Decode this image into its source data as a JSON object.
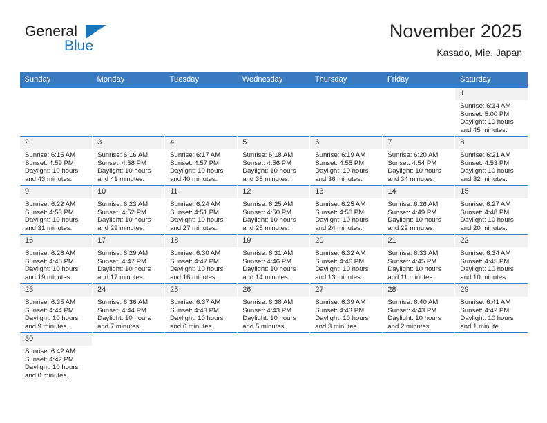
{
  "brand": {
    "name_part1": "General",
    "name_part2": "Blue",
    "flag_icon": "triangle-flag-icon",
    "accent_color": "#1b75bb"
  },
  "header": {
    "title": "November 2025",
    "subtitle": "Kasado, Mie, Japan"
  },
  "calendar": {
    "header_bg": "#3a7ac0",
    "daynum_bg": "#f2f2f2",
    "weekdays": [
      "Sunday",
      "Monday",
      "Tuesday",
      "Wednesday",
      "Thursday",
      "Friday",
      "Saturday"
    ],
    "weeks": [
      [
        {
          "day": "",
          "blank": true
        },
        {
          "day": "",
          "blank": true
        },
        {
          "day": "",
          "blank": true
        },
        {
          "day": "",
          "blank": true
        },
        {
          "day": "",
          "blank": true
        },
        {
          "day": "",
          "blank": true
        },
        {
          "day": "1",
          "sunrise": "Sunrise: 6:14 AM",
          "sunset": "Sunset: 5:00 PM",
          "daylight": "Daylight: 10 hours and 45 minutes."
        }
      ],
      [
        {
          "day": "2",
          "sunrise": "Sunrise: 6:15 AM",
          "sunset": "Sunset: 4:59 PM",
          "daylight": "Daylight: 10 hours and 43 minutes."
        },
        {
          "day": "3",
          "sunrise": "Sunrise: 6:16 AM",
          "sunset": "Sunset: 4:58 PM",
          "daylight": "Daylight: 10 hours and 41 minutes."
        },
        {
          "day": "4",
          "sunrise": "Sunrise: 6:17 AM",
          "sunset": "Sunset: 4:57 PM",
          "daylight": "Daylight: 10 hours and 40 minutes."
        },
        {
          "day": "5",
          "sunrise": "Sunrise: 6:18 AM",
          "sunset": "Sunset: 4:56 PM",
          "daylight": "Daylight: 10 hours and 38 minutes."
        },
        {
          "day": "6",
          "sunrise": "Sunrise: 6:19 AM",
          "sunset": "Sunset: 4:55 PM",
          "daylight": "Daylight: 10 hours and 36 minutes."
        },
        {
          "day": "7",
          "sunrise": "Sunrise: 6:20 AM",
          "sunset": "Sunset: 4:54 PM",
          "daylight": "Daylight: 10 hours and 34 minutes."
        },
        {
          "day": "8",
          "sunrise": "Sunrise: 6:21 AM",
          "sunset": "Sunset: 4:53 PM",
          "daylight": "Daylight: 10 hours and 32 minutes."
        }
      ],
      [
        {
          "day": "9",
          "sunrise": "Sunrise: 6:22 AM",
          "sunset": "Sunset: 4:53 PM",
          "daylight": "Daylight: 10 hours and 31 minutes."
        },
        {
          "day": "10",
          "sunrise": "Sunrise: 6:23 AM",
          "sunset": "Sunset: 4:52 PM",
          "daylight": "Daylight: 10 hours and 29 minutes."
        },
        {
          "day": "11",
          "sunrise": "Sunrise: 6:24 AM",
          "sunset": "Sunset: 4:51 PM",
          "daylight": "Daylight: 10 hours and 27 minutes."
        },
        {
          "day": "12",
          "sunrise": "Sunrise: 6:25 AM",
          "sunset": "Sunset: 4:50 PM",
          "daylight": "Daylight: 10 hours and 25 minutes."
        },
        {
          "day": "13",
          "sunrise": "Sunrise: 6:25 AM",
          "sunset": "Sunset: 4:50 PM",
          "daylight": "Daylight: 10 hours and 24 minutes."
        },
        {
          "day": "14",
          "sunrise": "Sunrise: 6:26 AM",
          "sunset": "Sunset: 4:49 PM",
          "daylight": "Daylight: 10 hours and 22 minutes."
        },
        {
          "day": "15",
          "sunrise": "Sunrise: 6:27 AM",
          "sunset": "Sunset: 4:48 PM",
          "daylight": "Daylight: 10 hours and 20 minutes."
        }
      ],
      [
        {
          "day": "16",
          "sunrise": "Sunrise: 6:28 AM",
          "sunset": "Sunset: 4:48 PM",
          "daylight": "Daylight: 10 hours and 19 minutes."
        },
        {
          "day": "17",
          "sunrise": "Sunrise: 6:29 AM",
          "sunset": "Sunset: 4:47 PM",
          "daylight": "Daylight: 10 hours and 17 minutes."
        },
        {
          "day": "18",
          "sunrise": "Sunrise: 6:30 AM",
          "sunset": "Sunset: 4:47 PM",
          "daylight": "Daylight: 10 hours and 16 minutes."
        },
        {
          "day": "19",
          "sunrise": "Sunrise: 6:31 AM",
          "sunset": "Sunset: 4:46 PM",
          "daylight": "Daylight: 10 hours and 14 minutes."
        },
        {
          "day": "20",
          "sunrise": "Sunrise: 6:32 AM",
          "sunset": "Sunset: 4:46 PM",
          "daylight": "Daylight: 10 hours and 13 minutes."
        },
        {
          "day": "21",
          "sunrise": "Sunrise: 6:33 AM",
          "sunset": "Sunset: 4:45 PM",
          "daylight": "Daylight: 10 hours and 11 minutes."
        },
        {
          "day": "22",
          "sunrise": "Sunrise: 6:34 AM",
          "sunset": "Sunset: 4:45 PM",
          "daylight": "Daylight: 10 hours and 10 minutes."
        }
      ],
      [
        {
          "day": "23",
          "sunrise": "Sunrise: 6:35 AM",
          "sunset": "Sunset: 4:44 PM",
          "daylight": "Daylight: 10 hours and 9 minutes."
        },
        {
          "day": "24",
          "sunrise": "Sunrise: 6:36 AM",
          "sunset": "Sunset: 4:44 PM",
          "daylight": "Daylight: 10 hours and 7 minutes."
        },
        {
          "day": "25",
          "sunrise": "Sunrise: 6:37 AM",
          "sunset": "Sunset: 4:43 PM",
          "daylight": "Daylight: 10 hours and 6 minutes."
        },
        {
          "day": "26",
          "sunrise": "Sunrise: 6:38 AM",
          "sunset": "Sunset: 4:43 PM",
          "daylight": "Daylight: 10 hours and 5 minutes."
        },
        {
          "day": "27",
          "sunrise": "Sunrise: 6:39 AM",
          "sunset": "Sunset: 4:43 PM",
          "daylight": "Daylight: 10 hours and 3 minutes."
        },
        {
          "day": "28",
          "sunrise": "Sunrise: 6:40 AM",
          "sunset": "Sunset: 4:43 PM",
          "daylight": "Daylight: 10 hours and 2 minutes."
        },
        {
          "day": "29",
          "sunrise": "Sunrise: 6:41 AM",
          "sunset": "Sunset: 4:42 PM",
          "daylight": "Daylight: 10 hours and 1 minute."
        }
      ],
      [
        {
          "day": "30",
          "sunrise": "Sunrise: 6:42 AM",
          "sunset": "Sunset: 4:42 PM",
          "daylight": "Daylight: 10 hours and 0 minutes."
        },
        {
          "day": "",
          "blank": true
        },
        {
          "day": "",
          "blank": true
        },
        {
          "day": "",
          "blank": true
        },
        {
          "day": "",
          "blank": true
        },
        {
          "day": "",
          "blank": true
        },
        {
          "day": "",
          "blank": true
        }
      ]
    ]
  }
}
